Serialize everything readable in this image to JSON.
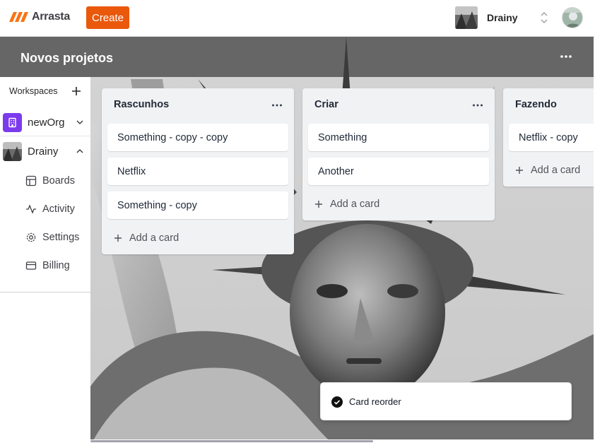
{
  "brand": {
    "name": "Arrasta",
    "accent": "#ea580c"
  },
  "navbar": {
    "create_label": "Create",
    "org_switcher": {
      "name": "Drainy",
      "icon": "chevron-up-down-icon"
    },
    "user_avatar_icon": "user-avatar"
  },
  "sidebar": {
    "workspaces_label": "Workspaces",
    "add_icon": "plus-icon",
    "orgs": [
      {
        "label": "newOrg",
        "icon": "building-icon",
        "expanded": false
      },
      {
        "label": "Drainy",
        "icon": "org-photo",
        "expanded": true
      }
    ],
    "items": [
      {
        "label": "Boards",
        "icon": "layout-icon"
      },
      {
        "label": "Activity",
        "icon": "activity-icon"
      },
      {
        "label": "Settings",
        "icon": "gear-icon"
      },
      {
        "label": "Billing",
        "icon": "credit-card-icon"
      }
    ]
  },
  "board": {
    "title": "Novos projetos",
    "menu_icon": "more-horizontal-icon",
    "lists": [
      {
        "title": "Rascunhos",
        "cards": [
          "Something - copy - copy",
          "Netflix",
          "Something - copy"
        ],
        "add_label": "Add a card"
      },
      {
        "title": "Criar",
        "cards": [
          "Something",
          "Another"
        ],
        "add_label": "Add a card"
      },
      {
        "title": "Fazendo",
        "cards": [
          "Netflix - copy"
        ],
        "add_label": "Add a card"
      }
    ]
  },
  "toast": {
    "message": "Card reorder",
    "icon": "check-circle-icon"
  }
}
